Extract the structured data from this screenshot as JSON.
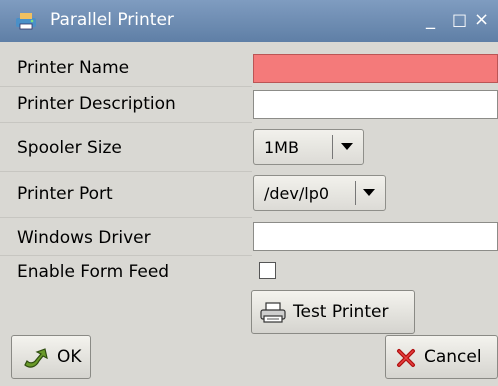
{
  "window": {
    "title": "Parallel Printer",
    "controls": {
      "minimize": "_",
      "maximize": "□",
      "close": "×"
    },
    "icon": "printer-app-icon"
  },
  "form": {
    "printer_name": {
      "label": "Printer Name",
      "value": "",
      "state": "invalid"
    },
    "printer_description": {
      "label": "Printer Description",
      "value": ""
    },
    "spooler_size": {
      "label": "Spooler Size",
      "value": "1MB"
    },
    "printer_port": {
      "label": "Printer Port",
      "value": "/dev/lp0"
    },
    "windows_driver": {
      "label": "Windows Driver",
      "value": ""
    },
    "enable_form_feed": {
      "label": "Enable Form Feed",
      "checked": false
    }
  },
  "buttons": {
    "test_printer": "Test Printer",
    "ok": "OK",
    "cancel": "Cancel"
  },
  "colors": {
    "titlebar": "#6f8eb5",
    "error_field": "#f47a7a",
    "window_bg": "#d9d8d3"
  }
}
